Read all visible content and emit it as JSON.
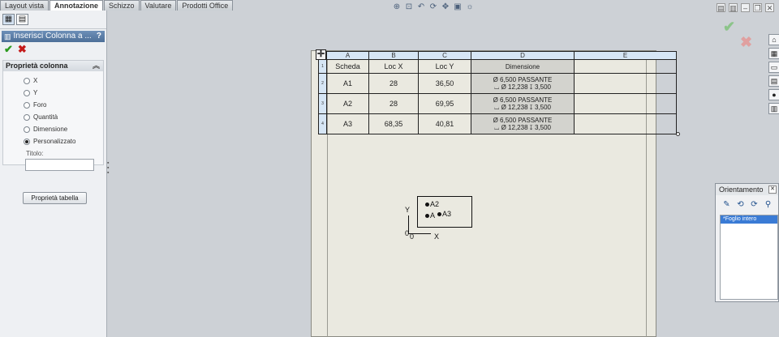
{
  "tabs": [
    "Layout vista",
    "Annotazione",
    "Schizzo",
    "Valutare",
    "Prodotti Office"
  ],
  "property_manager": {
    "title": "Inserisci Colonna a ...",
    "help": "?",
    "group_title": "Proprietà colonna",
    "options": [
      "X",
      "Y",
      "Foro",
      "Quantità",
      "Dimensione",
      "Personalizzato"
    ],
    "selected_option": "Personalizzato",
    "title_label": "Titolo:",
    "title_value": "",
    "table_props_button": "Proprietà tabella"
  },
  "table": {
    "column_letters": [
      "A",
      "B",
      "C",
      "D",
      "E"
    ],
    "row_numbers": [
      "1",
      "2",
      "3",
      "4"
    ],
    "headers": [
      "Scheda",
      "Loc X",
      "Loc Y",
      "Dimensione"
    ],
    "rows": [
      {
        "tag": "A1",
        "x": "28",
        "y": "36,50",
        "dim1": "Ø 6,500 PASSANTE",
        "dim2": "⌴ Ø 12,238 ↧ 3,500"
      },
      {
        "tag": "A2",
        "x": "28",
        "y": "69,95",
        "dim1": "Ø 6,500 PASSANTE",
        "dim2": "⌴ Ø 12,238 ↧ 3,500"
      },
      {
        "tag": "A3",
        "x": "68,35",
        "y": "40,81",
        "dim1": "Ø 6,500 PASSANTE",
        "dim2": "⌴ Ø 12,238 ↧ 3,500"
      }
    ]
  },
  "drawing_view": {
    "labels": [
      "A2",
      "A",
      "A3"
    ],
    "axis_y": "Y",
    "axis_x": "X",
    "origin": "0"
  },
  "orientation": {
    "title": "Orientamento",
    "item": "*Foglio intero"
  },
  "icons": {
    "viewbar": [
      "zoom-fit-icon",
      "zoom-area-icon",
      "previous-view-icon",
      "rotate-icon",
      "pan-icon",
      "display-style-icon",
      "view-settings-icon"
    ],
    "taskpane": [
      "resources-icon",
      "design-library-icon",
      "file-explorer-icon",
      "view-palette-icon",
      "appearances-icon",
      "custom-properties-icon"
    ]
  }
}
